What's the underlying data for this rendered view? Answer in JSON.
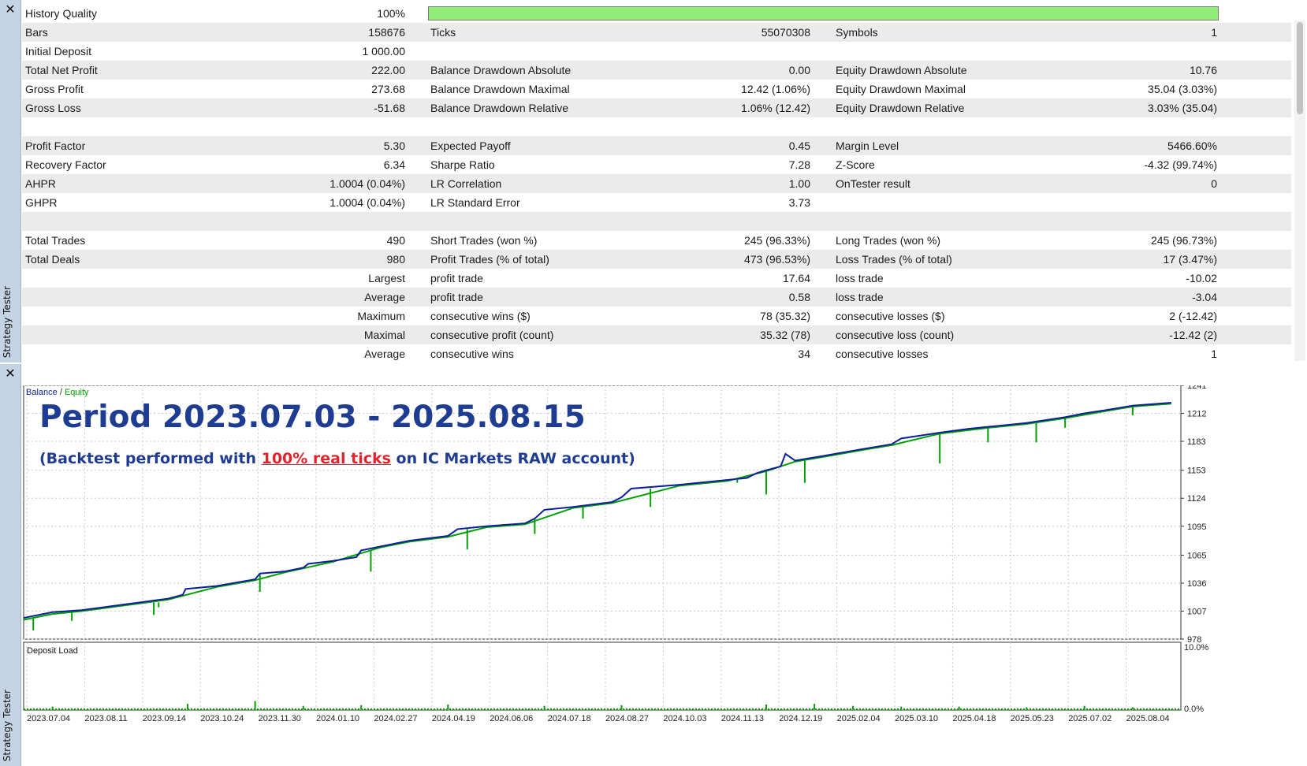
{
  "left_panel": {
    "close_icon": "✕",
    "vertical_label": "Strategy Tester"
  },
  "report": {
    "rows": [
      {
        "alt": false,
        "c1_label": "History Quality",
        "c1_value": "100%",
        "c2_label": "",
        "c2_value": "",
        "c3_label": "",
        "c3_value": ""
      },
      {
        "alt": true,
        "c1_label": "Bars",
        "c1_value": "158676",
        "c2_label": "Ticks",
        "c2_value": "55070308",
        "c3_label": "Symbols",
        "c3_value": "1"
      },
      {
        "alt": false,
        "c1_label": "Initial Deposit",
        "c1_value": "1 000.00",
        "c2_label": "",
        "c2_value": "",
        "c3_label": "",
        "c3_value": ""
      },
      {
        "alt": true,
        "c1_label": "Total Net Profit",
        "c1_value": "222.00",
        "c2_label": "Balance Drawdown Absolute",
        "c2_value": "0.00",
        "c3_label": "Equity Drawdown Absolute",
        "c3_value": "10.76"
      },
      {
        "alt": false,
        "c1_label": "Gross Profit",
        "c1_value": "273.68",
        "c2_label": "Balance Drawdown Maximal",
        "c2_value": "12.42 (1.06%)",
        "c3_label": "Equity Drawdown Maximal",
        "c3_value": "35.04 (3.03%)"
      },
      {
        "alt": true,
        "c1_label": "Gross Loss",
        "c1_value": "-51.68",
        "c2_label": "Balance Drawdown Relative",
        "c2_value": "1.06% (12.42)",
        "c3_label": "Equity Drawdown Relative",
        "c3_value": "3.03% (35.04)"
      },
      {
        "alt": false,
        "c1_label": "",
        "c1_value": "",
        "c2_label": "",
        "c2_value": "",
        "c3_label": "",
        "c3_value": ""
      },
      {
        "alt": true,
        "c1_label": "Profit Factor",
        "c1_value": "5.30",
        "c2_label": "Expected Payoff",
        "c2_value": "0.45",
        "c3_label": "Margin Level",
        "c3_value": "5466.60%"
      },
      {
        "alt": false,
        "c1_label": "Recovery Factor",
        "c1_value": "6.34",
        "c2_label": "Sharpe Ratio",
        "c2_value": "7.28",
        "c3_label": "Z-Score",
        "c3_value": "-4.32 (99.74%)"
      },
      {
        "alt": true,
        "c1_label": "AHPR",
        "c1_value": "1.0004 (0.04%)",
        "c2_label": "LR Correlation",
        "c2_value": "1.00",
        "c3_label": "OnTester result",
        "c3_value": "0"
      },
      {
        "alt": false,
        "c1_label": "GHPR",
        "c1_value": "1.0004 (0.04%)",
        "c2_label": "LR Standard Error",
        "c2_value": "3.73",
        "c3_label": "",
        "c3_value": ""
      },
      {
        "alt": true,
        "c1_label": "",
        "c1_value": "",
        "c2_label": "",
        "c2_value": "",
        "c3_label": "",
        "c3_value": ""
      },
      {
        "alt": false,
        "c1_label": "Total Trades",
        "c1_value": "490",
        "c2_label": "Short Trades (won %)",
        "c2_value": "245 (96.33%)",
        "c3_label": "Long Trades (won %)",
        "c3_value": "245 (96.73%)"
      },
      {
        "alt": true,
        "c1_label": "Total Deals",
        "c1_value": "980",
        "c2_label": "Profit Trades (% of total)",
        "c2_value": "473 (96.53%)",
        "c3_label": "Loss Trades (% of total)",
        "c3_value": "17 (3.47%)"
      },
      {
        "alt": false,
        "c1_label": "",
        "c1_value": "Largest",
        "c2_label": "profit trade",
        "c2_value": "17.64",
        "c3_label": "loss trade",
        "c3_value": "-10.02"
      },
      {
        "alt": true,
        "c1_label": "",
        "c1_value": "Average",
        "c2_label": "profit trade",
        "c2_value": "0.58",
        "c3_label": "loss trade",
        "c3_value": "-3.04"
      },
      {
        "alt": false,
        "c1_label": "",
        "c1_value": "Maximum",
        "c2_label": "consecutive wins ($)",
        "c2_value": "78 (35.32)",
        "c3_label": "consecutive losses ($)",
        "c3_value": "2 (-12.42)"
      },
      {
        "alt": true,
        "c1_label": "",
        "c1_value": "Maximal",
        "c2_label": "consecutive profit (count)",
        "c2_value": "35.32 (78)",
        "c3_label": "consecutive loss (count)",
        "c3_value": "-12.42 (2)"
      },
      {
        "alt": false,
        "c1_label": "",
        "c1_value": "Average",
        "c2_label": "consecutive wins",
        "c2_value": "34",
        "c3_label": "consecutive losses",
        "c3_value": "1"
      },
      {
        "alt": true,
        "c1_label": "",
        "c1_value": "",
        "c2_label": "",
        "c2_value": "",
        "c3_label": "",
        "c3_value": ""
      }
    ],
    "history_quality_fraction": 1.0,
    "history_quality_color": "#90ee78"
  },
  "graph": {
    "legend_balance": "Balance",
    "legend_sep": " / ",
    "legend_equity": "Equity",
    "title": "Period 2023.07.03 - 2025.08.15",
    "subtitle_pre": "(Backtest performed with ",
    "subtitle_highlight": "100% real ticks",
    "subtitle_post": " on IC Markets RAW account)",
    "deposit_load_label": "Deposit Load",
    "deposit_load_top": "10.0%",
    "deposit_load_bottom": "0.0%",
    "colors": {
      "balance": "#0a1f9c",
      "equity": "#00a000",
      "title": "#1f3c93",
      "highlight": "#e3232c"
    }
  },
  "chart_data": {
    "type": "line",
    "title": "Period 2023.07.03 - 2025.08.15",
    "xlabel": "",
    "ylabel": "",
    "ylim": [
      978,
      1241
    ],
    "y_ticks": [
      1241,
      1212,
      1183,
      1153,
      1124,
      1095,
      1065,
      1036,
      1007,
      978
    ],
    "x_tick_labels": [
      "2023.07.04",
      "2023.08.11",
      "2023.09.14",
      "2023.10.24",
      "2023.11.30",
      "2024.01.10",
      "2024.02.27",
      "2024.04.19",
      "2024.06.06",
      "2024.07.18",
      "2024.08.27",
      "2024.10.03",
      "2024.11.13",
      "2024.12.19",
      "2025.02.04",
      "2025.03.10",
      "2025.04.18",
      "2025.05.23",
      "2025.07.02",
      "2025.08.04"
    ],
    "x_range": [
      0,
      1
    ],
    "grid": true,
    "legend": "top-left",
    "series": [
      {
        "name": "Balance",
        "points": [
          [
            0.0,
            1000
          ],
          [
            0.03,
            1006
          ],
          [
            0.06,
            1008
          ],
          [
            0.09,
            1012
          ],
          [
            0.12,
            1016
          ],
          [
            0.15,
            1020
          ],
          [
            0.165,
            1024
          ],
          [
            0.168,
            1030
          ],
          [
            0.2,
            1033
          ],
          [
            0.24,
            1040
          ],
          [
            0.245,
            1046
          ],
          [
            0.27,
            1048
          ],
          [
            0.28,
            1050
          ],
          [
            0.29,
            1052
          ],
          [
            0.295,
            1056
          ],
          [
            0.32,
            1059
          ],
          [
            0.345,
            1063
          ],
          [
            0.35,
            1070
          ],
          [
            0.37,
            1074
          ],
          [
            0.4,
            1080
          ],
          [
            0.44,
            1085
          ],
          [
            0.45,
            1092
          ],
          [
            0.48,
            1095
          ],
          [
            0.52,
            1098
          ],
          [
            0.53,
            1103
          ],
          [
            0.54,
            1112
          ],
          [
            0.57,
            1115
          ],
          [
            0.61,
            1120
          ],
          [
            0.62,
            1125
          ],
          [
            0.63,
            1134
          ],
          [
            0.68,
            1138
          ],
          [
            0.73,
            1143
          ],
          [
            0.75,
            1145
          ],
          [
            0.76,
            1150
          ],
          [
            0.77,
            1153
          ],
          [
            0.785,
            1157
          ],
          [
            0.79,
            1170
          ],
          [
            0.8,
            1163
          ],
          [
            0.83,
            1168
          ],
          [
            0.87,
            1175
          ],
          [
            0.9,
            1180
          ],
          [
            0.91,
            1186
          ],
          [
            0.95,
            1192
          ],
          [
            0.98,
            1196
          ],
          [
            1.0,
            1198
          ],
          [
            1.04,
            1202
          ],
          [
            1.08,
            1208
          ],
          [
            1.1,
            1212
          ],
          [
            1.12,
            1215
          ],
          [
            1.15,
            1220
          ],
          [
            1.19,
            1223
          ]
        ]
      },
      {
        "name": "Equity",
        "points": [
          [
            0.0,
            998
          ],
          [
            0.03,
            1004
          ],
          [
            0.06,
            1007
          ],
          [
            0.09,
            1011
          ],
          [
            0.12,
            1015
          ],
          [
            0.15,
            1019
          ],
          [
            0.2,
            1032
          ],
          [
            0.24,
            1039
          ],
          [
            0.27,
            1047
          ],
          [
            0.32,
            1058
          ],
          [
            0.37,
            1073
          ],
          [
            0.4,
            1079
          ],
          [
            0.44,
            1084
          ],
          [
            0.48,
            1094
          ],
          [
            0.52,
            1097
          ],
          [
            0.57,
            1114
          ],
          [
            0.61,
            1119
          ],
          [
            0.68,
            1137
          ],
          [
            0.73,
            1142
          ],
          [
            0.77,
            1152
          ],
          [
            0.8,
            1162
          ],
          [
            0.83,
            1167
          ],
          [
            0.87,
            1174
          ],
          [
            0.9,
            1179
          ],
          [
            0.95,
            1191
          ],
          [
            1.0,
            1197
          ],
          [
            1.04,
            1201
          ],
          [
            1.08,
            1207
          ],
          [
            1.12,
            1214
          ],
          [
            1.15,
            1219
          ],
          [
            1.19,
            1222
          ]
        ]
      }
    ],
    "equity_dips": [
      [
        0.01,
        987
      ],
      [
        0.05,
        997
      ],
      [
        0.135,
        1003
      ],
      [
        0.14,
        1011
      ],
      [
        0.245,
        1027
      ],
      [
        0.36,
        1048
      ],
      [
        0.46,
        1071
      ],
      [
        0.53,
        1087
      ],
      [
        0.58,
        1103
      ],
      [
        0.65,
        1115
      ],
      [
        0.74,
        1140
      ],
      [
        0.77,
        1128
      ],
      [
        0.81,
        1140
      ],
      [
        0.95,
        1160
      ],
      [
        1.0,
        1182
      ],
      [
        1.05,
        1182
      ],
      [
        1.08,
        1197
      ],
      [
        1.15,
        1210
      ]
    ],
    "deposit_load": {
      "type": "bar",
      "ylim": [
        0,
        10
      ],
      "spikes": [
        [
          0.03,
          0.4
        ],
        [
          0.17,
          0.8
        ],
        [
          0.24,
          1.2
        ],
        [
          0.29,
          0.5
        ],
        [
          0.35,
          0.6
        ],
        [
          0.44,
          0.7
        ],
        [
          0.54,
          0.5
        ],
        [
          0.62,
          0.6
        ],
        [
          0.77,
          0.7
        ],
        [
          0.82,
          0.8
        ],
        [
          0.86,
          0.5
        ],
        [
          0.91,
          0.4
        ],
        [
          0.97,
          0.4
        ],
        [
          1.04,
          0.3
        ],
        [
          1.1,
          0.5
        ],
        [
          1.15,
          0.3
        ]
      ]
    }
  }
}
